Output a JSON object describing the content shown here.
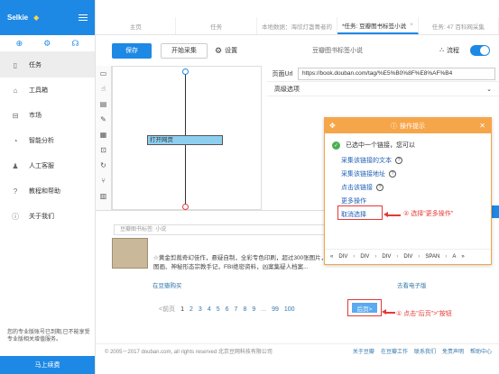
{
  "app": {
    "name": "Selkie",
    "vip_icon": "diamond-icon"
  },
  "sidebar": {
    "icon_row": [
      "plus-icon",
      "gear-icon",
      "headset-icon"
    ],
    "items": [
      {
        "icon": "document-icon",
        "label": "任务",
        "glyph": "🗋"
      },
      {
        "icon": "toolbox-icon",
        "label": "工具箱",
        "glyph": "⌂"
      },
      {
        "icon": "market-icon",
        "label": "市场",
        "glyph": "⊟"
      },
      {
        "icon": "analytics-icon",
        "label": "智能分析",
        "glyph": "◔"
      },
      {
        "icon": "support-icon",
        "label": "人工客服",
        "glyph": "♟"
      },
      {
        "icon": "help-icon",
        "label": "教程和帮助",
        "glyph": "?"
      },
      {
        "icon": "info-icon",
        "label": "关于我们",
        "glyph": "i"
      }
    ],
    "footer_text": "您的专业版账号已到期,已不能享受专业版相关增值服务。",
    "upgrade_label": "马上续费"
  },
  "tabs": [
    {
      "label": "主页"
    },
    {
      "label": "任务"
    },
    {
      "label": "本地数据：海欣灯盏菁者的"
    },
    {
      "label": "*任务: 豆瓣图书标签小说"
    },
    {
      "label": "任务: 47 百科网采集"
    },
    {
      "label": "任务: 47 百科网采集"
    }
  ],
  "toolbar": {
    "save_label": "保存",
    "start_label": "开始采集",
    "settings_label": "设置",
    "task_title": "豆瓣图书标签小说",
    "flow_label": "流程"
  },
  "workflow": {
    "node_label": "打开网页"
  },
  "properties": {
    "url_label": "页面Url",
    "url_value": "https://book.douban.com/tag/%E5%B0%8F%E8%AF%B4",
    "advanced_label": "高级选项"
  },
  "browser": {
    "address": "豆瓣图书标签: 小说",
    "book_desc": "☆黄金剪裁奇幻佳作，悬疑自制，全彩专色印刷，超过300张图片，神秘图画、神秘形态宗教手记，FBI绝密资料，凶案集疑人档案...",
    "buy_link": "在豆瓣购买",
    "ebook_link": "去看电子版",
    "pager": {
      "prev": "<前页",
      "current": "1",
      "pages": [
        "2",
        "3",
        "4",
        "5",
        "6",
        "7",
        "8",
        "9"
      ],
      "dots": "...",
      "tail": [
        "99",
        "100"
      ],
      "next": "后页>"
    },
    "footer_copy": "© 2005－2017 douban.com, all rights reserved 北京豆网科技有限公司",
    "footer_links": [
      "关于豆瓣",
      "在豆瓣工作",
      "联系我们",
      "免责声明",
      "帮助中心"
    ]
  },
  "popup": {
    "title": "操作提示",
    "message": "已选中一个链接，您可以",
    "links": [
      {
        "label": "采集该链接的文本",
        "help": true
      },
      {
        "label": "采集该链接地址",
        "help": true
      },
      {
        "label": "点击该链接",
        "help": true
      },
      {
        "label": "更多操作",
        "help": false
      },
      {
        "label": "取消选择",
        "help": false
      }
    ],
    "path": [
      "DIV",
      "DIV",
      "DIV",
      "DIV",
      "SPAN",
      "A"
    ],
    "path_sep": "›",
    "path_prev": "«",
    "path_next": "»"
  },
  "annotations": {
    "more_hint": "② 选择\"更多操作\"",
    "next_hint": "① 点击\"后页\">\"按钮"
  }
}
